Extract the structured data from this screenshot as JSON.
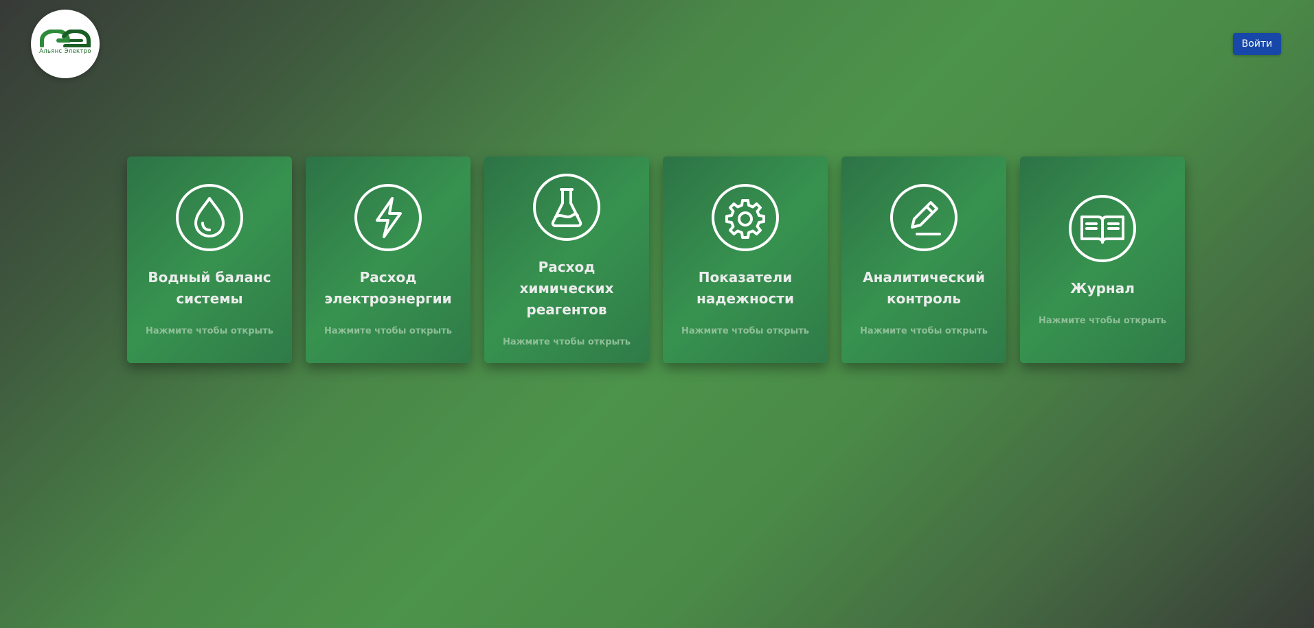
{
  "header": {
    "logo_text": "Альянс Электро",
    "login_label": "Войти"
  },
  "colors": {
    "accent_button": "#1747a8",
    "logo_green": "#1f6a2b",
    "card_green": "#37924f"
  },
  "cards": [
    {
      "title": "Водный баланс системы",
      "hint": "Нажмите чтобы открыть",
      "icon": "water-drop-icon"
    },
    {
      "title": "Расход электроэнергии",
      "hint": "Нажмите чтобы открыть",
      "icon": "lightning-icon"
    },
    {
      "title": "Расход химических реагентов",
      "hint": "Нажмите чтобы открыть",
      "icon": "flask-icon"
    },
    {
      "title": "Показатели надежности",
      "hint": "Нажмите чтобы открыть",
      "icon": "gear-icon"
    },
    {
      "title": "Аналитический контроль",
      "hint": "Нажмите чтобы открыть",
      "icon": "pencil-icon"
    },
    {
      "title": "Журнал",
      "hint": "Нажмите чтобы открыть",
      "icon": "book-icon"
    }
  ]
}
